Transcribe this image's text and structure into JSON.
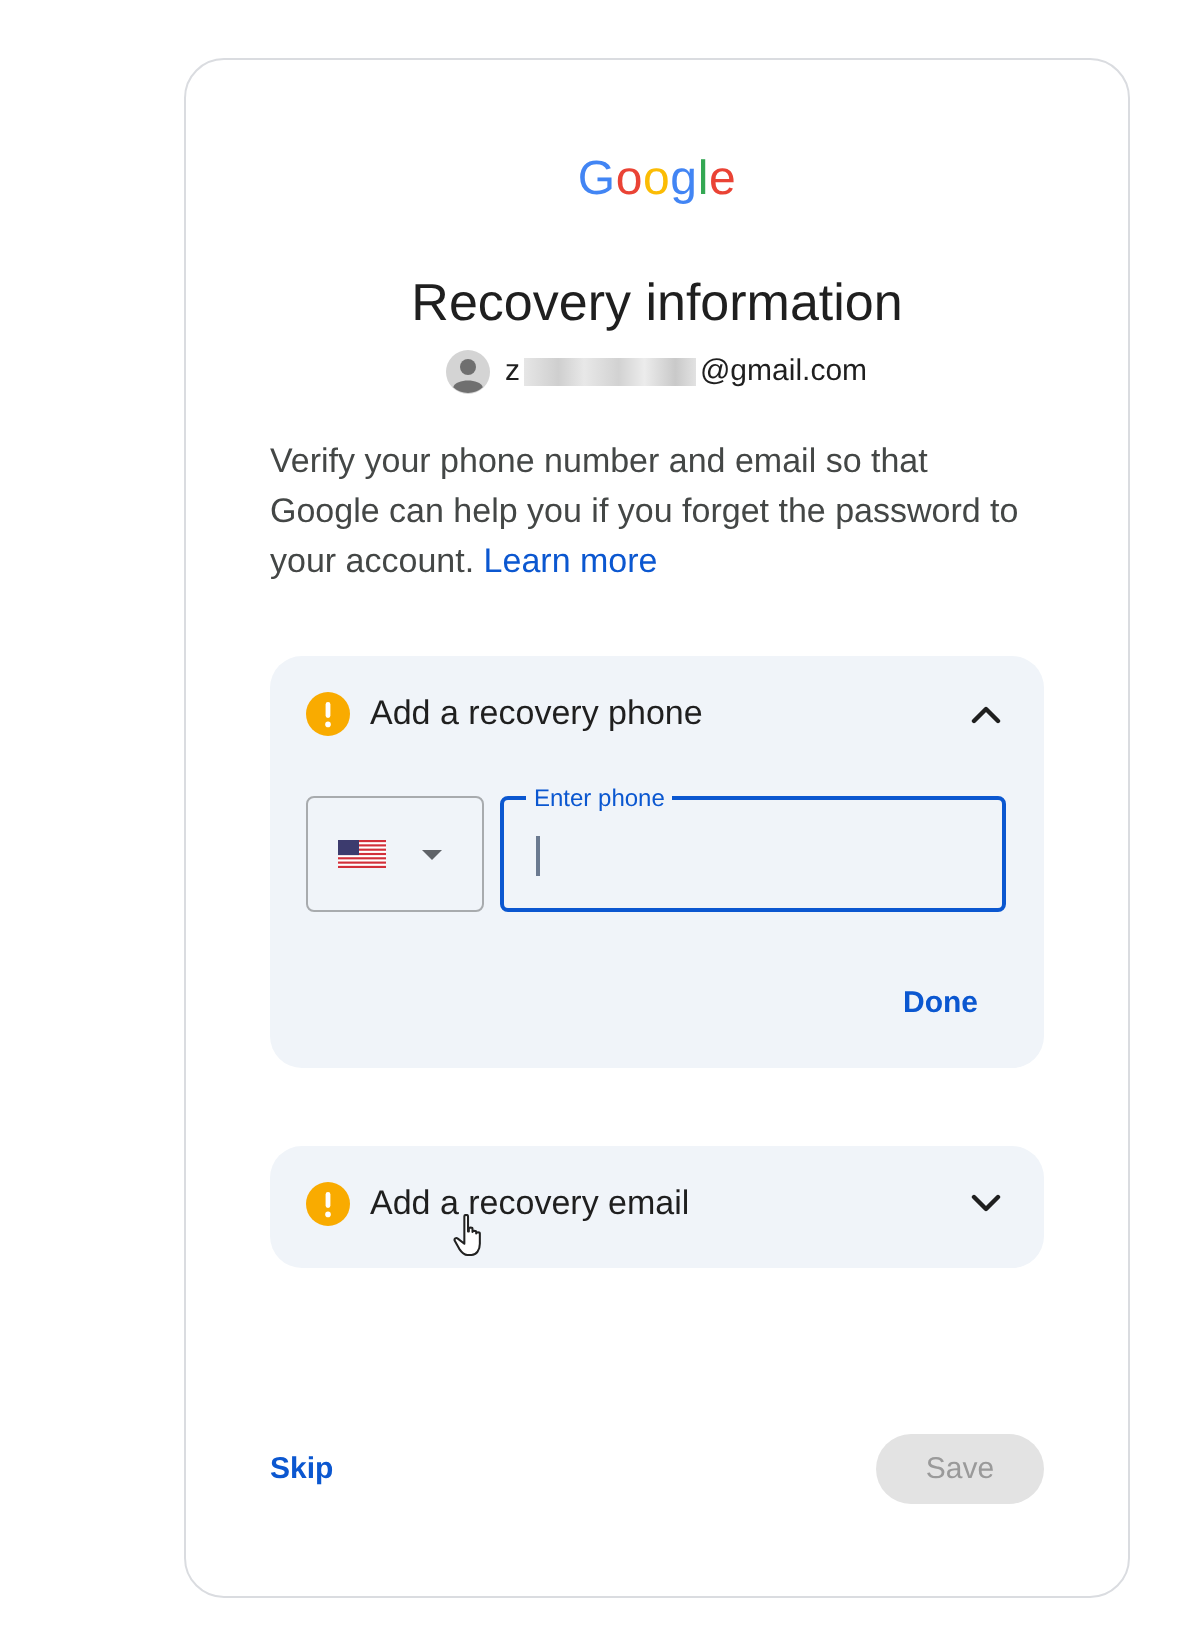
{
  "logo": "Google",
  "title": "Recovery information",
  "account": {
    "email_start": "z",
    "email_end": "@gmail.com"
  },
  "description": {
    "text": "Verify your phone number and email so that Google can help you if you forget the password to your account.",
    "link": "Learn more"
  },
  "sections": [
    {
      "kind": "phone",
      "title": "Add a recovery phone",
      "warning": true,
      "expanded": true,
      "phone_field": {
        "label": "Enter phone",
        "focused": true
      },
      "action": "Done"
    },
    {
      "kind": "email",
      "title": "Add a recovery email",
      "warning": true,
      "expanded": false
    }
  ],
  "footer": {
    "skip": "Skip",
    "save": {
      "label": "Save",
      "disabled": true
    }
  }
}
